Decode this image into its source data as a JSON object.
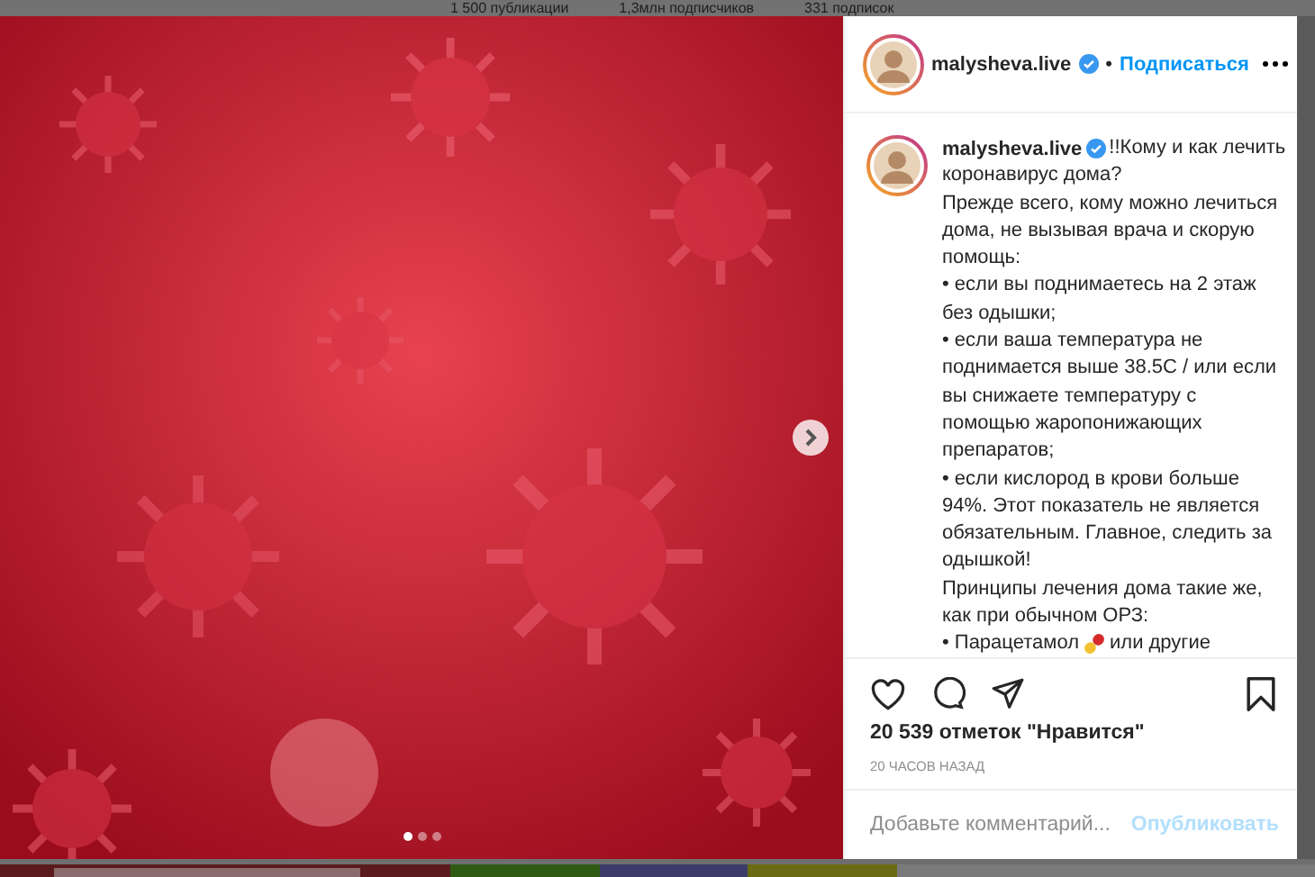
{
  "profile_stats": [
    "1 500 публикации",
    "1,3млн подписчиков",
    "331 подписок"
  ],
  "post": {
    "carousel": {
      "dots": [
        {
          "selected": true
        },
        {
          "selected": false
        },
        {
          "selected": false
        }
      ]
    },
    "header": {
      "username": "malysheva.live",
      "separator": "•",
      "follow": "Подписаться"
    },
    "caption": {
      "author": "malysheva.live",
      "first_line": "!!Кому и как лечить",
      "lines": [
        "коронавирус дома?",
        "Прежде всего, кому можно лечиться",
        "дома, не вызывая врача и скорую",
        "помощь:",
        "• если вы поднимаетесь на 2 этаж",
        "без одышки;",
        "• если ваша температура не",
        "поднимается выше 38.5С / или если",
        "вы снижаете температуру с",
        "помощью жаропонижающих",
        "препаратов;",
        "• если кислород в крови больше",
        "94%. Этот показатель не является",
        "обязательным. Главное, следить за",
        "одышкой!",
        "Принципы лечения дома такие же,",
        "как при обычном ОРЗ:"
      ],
      "pill_line": {
        "before": "• Парацетамол",
        "after": "или другие"
      }
    },
    "likes": "20 539 отметок \"Нравится\"",
    "time": "20 ЧАСОВ НАЗАД",
    "comment": {
      "placeholder": "Добавьте комментарий...",
      "submit": "Опубликовать",
      "submit_disabled": true
    }
  }
}
